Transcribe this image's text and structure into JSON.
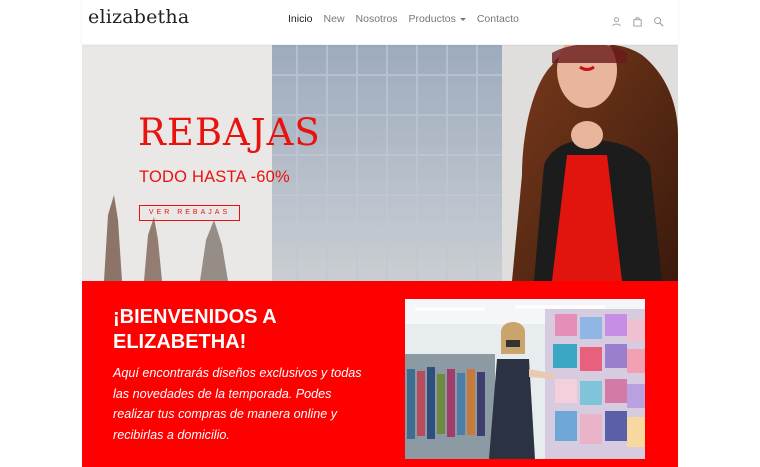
{
  "brand": {
    "logo": "elizabetha"
  },
  "nav": {
    "items": [
      "Inicio",
      "New",
      "Nosotros",
      "Productos",
      "Contacto"
    ],
    "active": "Inicio",
    "icons": [
      "user-icon",
      "bag-icon",
      "search-icon"
    ]
  },
  "hero": {
    "title": "REBAJAS",
    "subtitle": "TODO HASTA -60%",
    "button": "VER REBAJAS"
  },
  "welcome": {
    "title": "¡BIENVENIDOS A ELIZABETHA!",
    "text": "Aquí encontrarás diseños exclusivos y todas las novedades de la temporada. Podes realizar tus compras de manera online y recibirlas a domicilio."
  },
  "colors": {
    "accent": "#fe0000",
    "text_dark": "#222222",
    "nav_muted": "#777777"
  }
}
